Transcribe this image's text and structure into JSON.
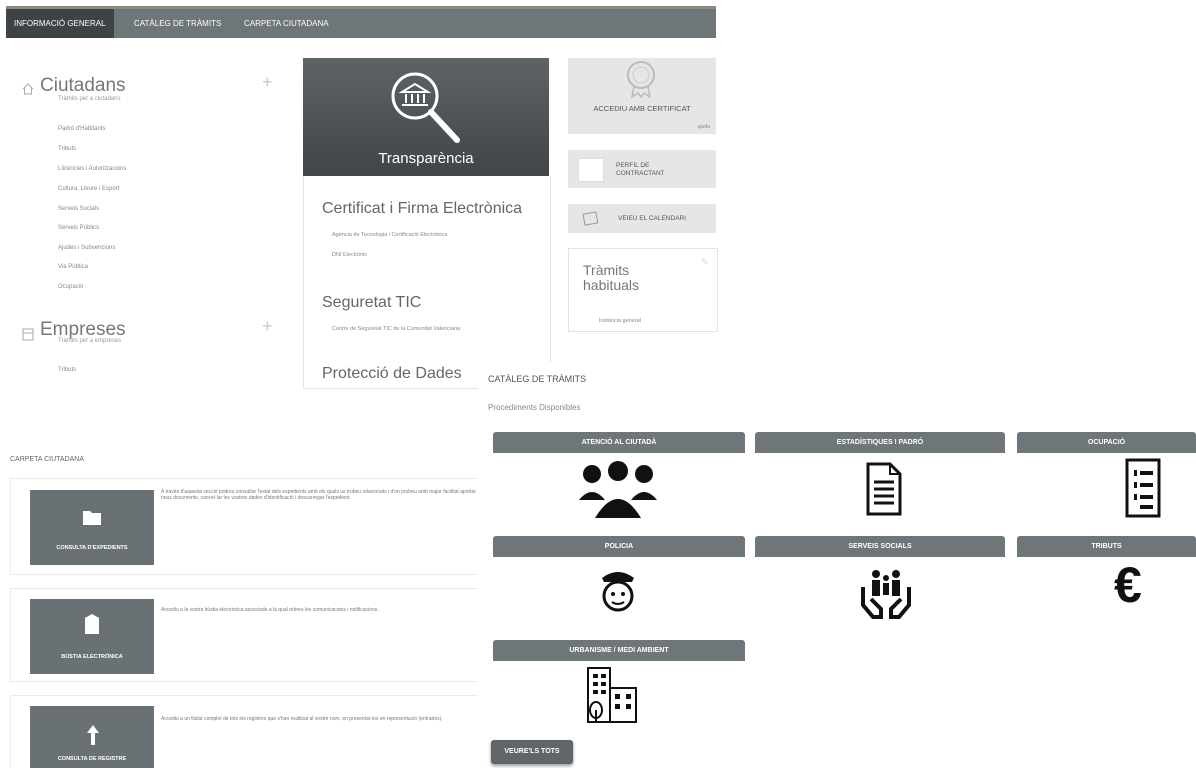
{
  "nav": {
    "tabs": [
      {
        "label": "INFORMACIÓ GENERAL"
      },
      {
        "label": "CATÀLEG DE TRÀMITS"
      },
      {
        "label": "CARPETA CIUTADANA"
      }
    ]
  },
  "ciutadans": {
    "title": "Ciutadans",
    "subtitle": "Tràmits per a ciutadans",
    "items": [
      "Padró d'Habitants",
      "Tributs",
      "Llicències i Autoritzacions",
      "Cultura, Lleure i Esport",
      "Serveis Socials",
      "Serveis Públics",
      "Ajudes i Subvencions",
      "Via Pública",
      "Ocupació"
    ]
  },
  "empreses": {
    "title": "Empreses",
    "subtitle": "Tràmits per a empreses",
    "items": [
      "Tributs"
    ]
  },
  "transparencia": {
    "label": "Transparència"
  },
  "certificat": {
    "title": "Certificat i Firma Electrònica",
    "links": [
      "Agència de Tecnologia i Certificació Electrònica",
      "DNI Electrònic"
    ]
  },
  "seguretat": {
    "title": "Seguretat TIC",
    "links": [
      "Centre de Seguretat TIC de la Comunitat Valenciana"
    ]
  },
  "proteccio": {
    "title": "Protecció de Dades"
  },
  "right": {
    "accediu": "ACCEDIU AMB CERTIFICAT",
    "ajuda": "ajuda",
    "perfil": "PERFIL DE\nCONTRACTANT",
    "calendari": "VEIEU EL CALENDARI",
    "habituals_title": "Tràmits habituals",
    "habituals_item": "Instància general"
  },
  "cataleg": {
    "title": "CATÀLEG DE TRÀMITS",
    "subtitle": "Procediments Disponibles",
    "categories": [
      "ATENCIÓ AL CIUTADÀ",
      "ESTADÍSTIQUES I PADRÓ",
      "OCUPACIÓ",
      "POLICIA",
      "SERVEIS SOCIALS",
      "TRIBUTS",
      "URBANISME / MEDI AMBIENT"
    ],
    "icons": [
      "people-icon",
      "document-icon",
      "list-document-icon",
      "police-icon",
      "family-care-icon",
      "euro-icon",
      "buildings-icon"
    ],
    "euro_symbol": "€",
    "button": "VEURE'LS TOTS"
  },
  "carpeta": {
    "title": "CARPETA CIUTADANA",
    "cards": [
      {
        "label": "CONSULTA D'EXPEDIENTS",
        "desc": "A través d'aquesta secció podreu consultar l'estat dels expedients amb els quals us trobeu relacionats i d'on podreu amb major facilitat aportar nous documents, cancel·lar les vostres dades d'identificació i descarregar l'expedient."
      },
      {
        "label": "BÚSTIA ELECTRÒNICA",
        "desc": "Accediu a la vostra bústia electrònica associada a la qual rebreu les comunicacions i notificacions."
      },
      {
        "label": "CONSULTA DE REGISTRE",
        "desc": "Accediu a un llistat complet de tots els registres que s'han realitzat al vostre nom, en presentar-los en representació (entrades)."
      }
    ]
  },
  "colors": {
    "nav": "#6f7679",
    "nav_active": "#3e4446",
    "tile": "#6a7175"
  }
}
